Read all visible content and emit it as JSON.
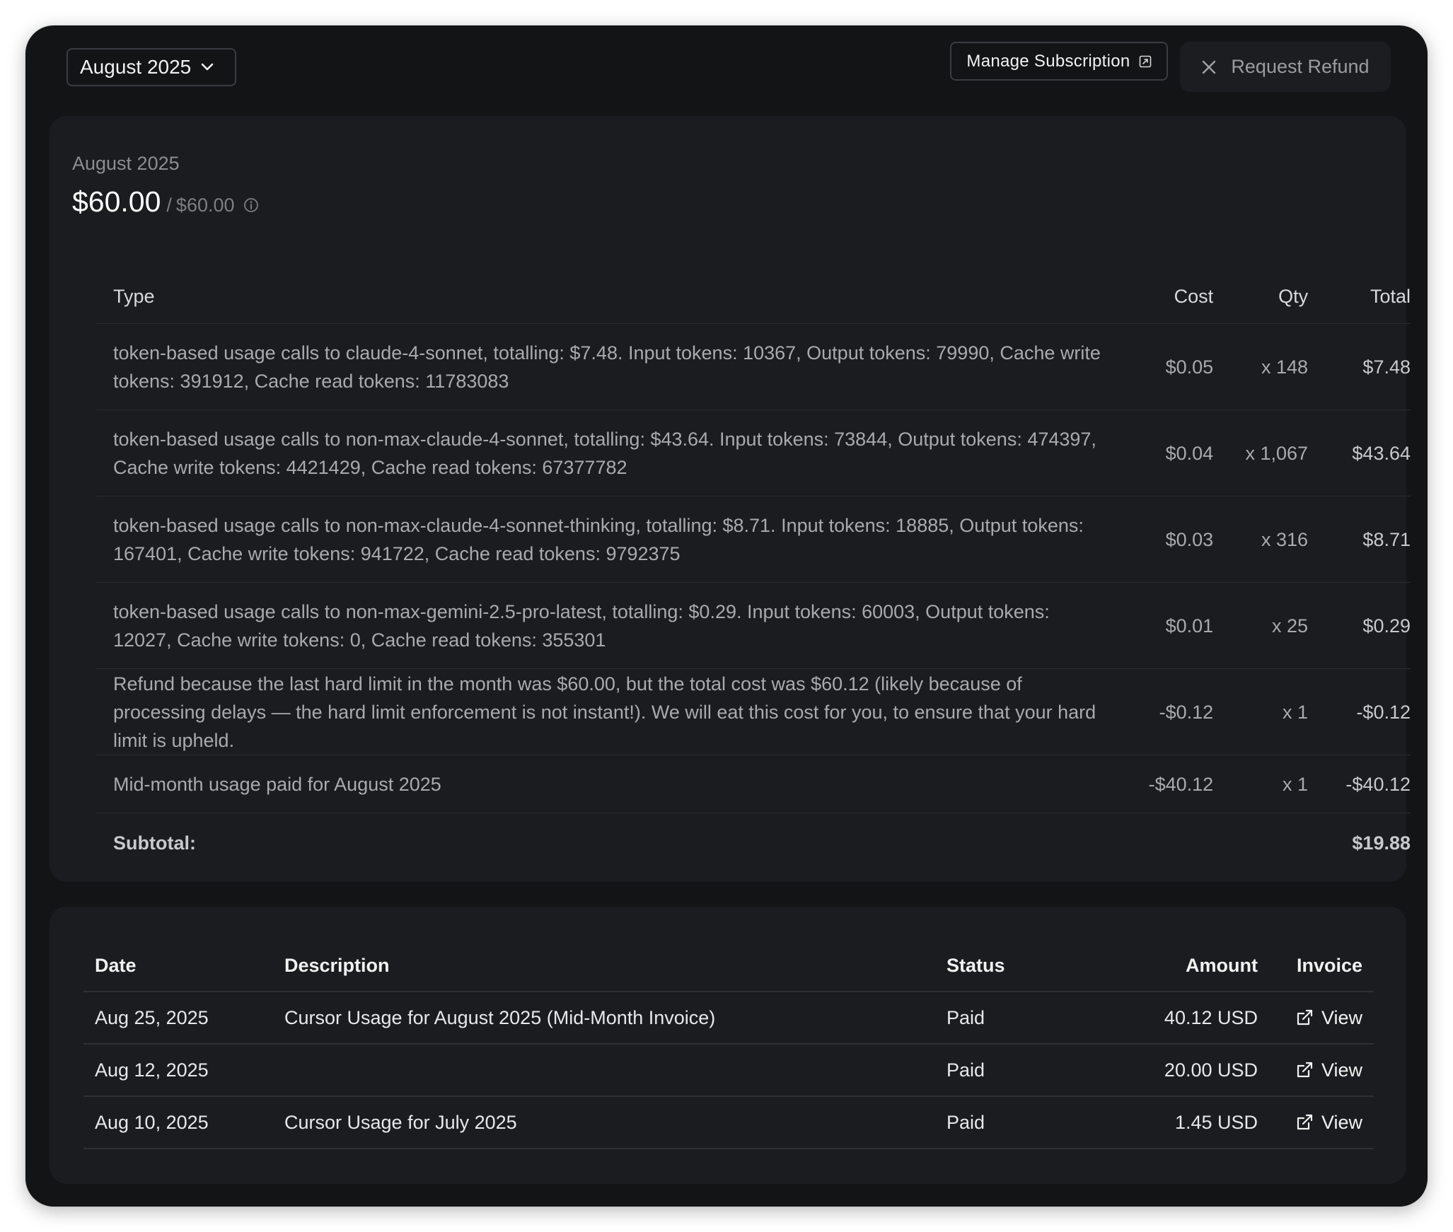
{
  "header": {
    "month_select": "August 2025",
    "manage_label": "Manage Subscription",
    "refund_label": "Request Refund"
  },
  "summary": {
    "period": "August 2025",
    "amount": "$60.00",
    "separator": "/",
    "limit": "$60.00"
  },
  "usage_table": {
    "headers": {
      "type": "Type",
      "cost": "Cost",
      "qty": "Qty",
      "total": "Total"
    },
    "rows": [
      {
        "type": "token-based usage calls to claude-4-sonnet, totalling: $7.48. Input tokens: 10367, Output tokens: 79990, Cache write tokens: 391912, Cache read tokens: 11783083",
        "cost": "$0.05",
        "qty": "x 148",
        "total": "$7.48"
      },
      {
        "type": "token-based usage calls to non-max-claude-4-sonnet, totalling: $43.64. Input tokens: 73844, Output tokens: 474397, Cache write tokens: 4421429, Cache read tokens: 67377782",
        "cost": "$0.04",
        "qty": "x 1,067",
        "total": "$43.64"
      },
      {
        "type": "token-based usage calls to non-max-claude-4-sonnet-thinking, totalling: $8.71. Input tokens: 18885, Output tokens: 167401, Cache write tokens: 941722, Cache read tokens: 9792375",
        "cost": "$0.03",
        "qty": "x 316",
        "total": "$8.71"
      },
      {
        "type": "token-based usage calls to non-max-gemini-2.5-pro-latest, totalling: $0.29. Input tokens: 60003, Output tokens: 12027, Cache write tokens: 0, Cache read tokens: 355301",
        "cost": "$0.01",
        "qty": "x 25",
        "total": "$0.29"
      },
      {
        "type": "Refund because the last hard limit in the month was $60.00, but the total cost was $60.12 (likely because of processing delays — the hard limit enforcement is not instant!). We will eat this cost for you, to ensure that your hard limit is upheld.",
        "cost": "-$0.12",
        "qty": "x 1",
        "total": "-$0.12"
      },
      {
        "type": "Mid-month usage paid for August 2025",
        "cost": "-$40.12",
        "qty": "x 1",
        "total": "-$40.12"
      }
    ],
    "subtotal_label": "Subtotal:",
    "subtotal_value": "$19.88"
  },
  "payments": {
    "headers": {
      "date": "Date",
      "description": "Description",
      "status": "Status",
      "amount": "Amount",
      "invoice": "Invoice"
    },
    "rows": [
      {
        "date": "Aug 25, 2025",
        "description": "Cursor Usage for August 2025 (Mid-Month Invoice)",
        "status": "Paid",
        "amount": "40.12 USD",
        "invoice": "View"
      },
      {
        "date": "Aug 12, 2025",
        "description": "",
        "status": "Paid",
        "amount": "20.00 USD",
        "invoice": "View"
      },
      {
        "date": "Aug 10, 2025",
        "description": "Cursor Usage for July 2025",
        "status": "Paid",
        "amount": "1.45 USD",
        "invoice": "View"
      }
    ]
  },
  "colors": {
    "window_bg": "#131416",
    "card_bg": "#1b1c1f",
    "muted_text": "#a8aaaf"
  },
  "icons": [
    "chevron-down-icon",
    "external-link-square-icon",
    "close-icon",
    "info-icon",
    "external-link-icon"
  ]
}
